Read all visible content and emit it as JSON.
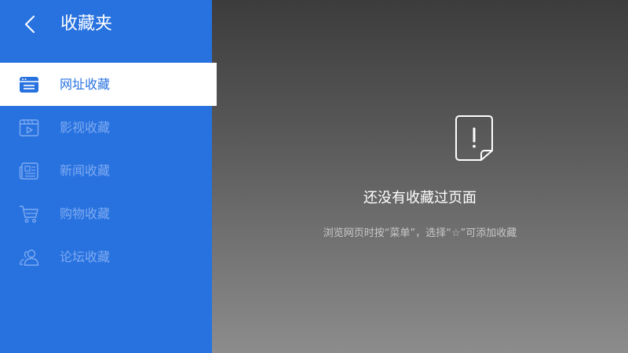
{
  "header": {
    "title": "收藏夹",
    "back_icon": "chevron-left-icon"
  },
  "sidebar": {
    "items": [
      {
        "label": "网址收藏",
        "icon": "browser-window-icon",
        "active": true
      },
      {
        "label": "影视收藏",
        "icon": "video-clapper-icon",
        "active": false
      },
      {
        "label": "新闻收藏",
        "icon": "newspaper-icon",
        "active": false
      },
      {
        "label": "购物收藏",
        "icon": "shopping-cart-icon",
        "active": false
      },
      {
        "label": "论坛收藏",
        "icon": "users-icon",
        "active": false
      }
    ]
  },
  "empty_state": {
    "icon": "exclamation-document-icon",
    "title": "还没有收藏过页面",
    "hint": "浏览网页时按“菜单”，选择“☆”可添加收藏"
  },
  "colors": {
    "sidebar_bg": "#2872e0",
    "active_item_bg": "#ffffff",
    "active_text": "#2872e0",
    "inactive_text": "#7eaaf0"
  }
}
